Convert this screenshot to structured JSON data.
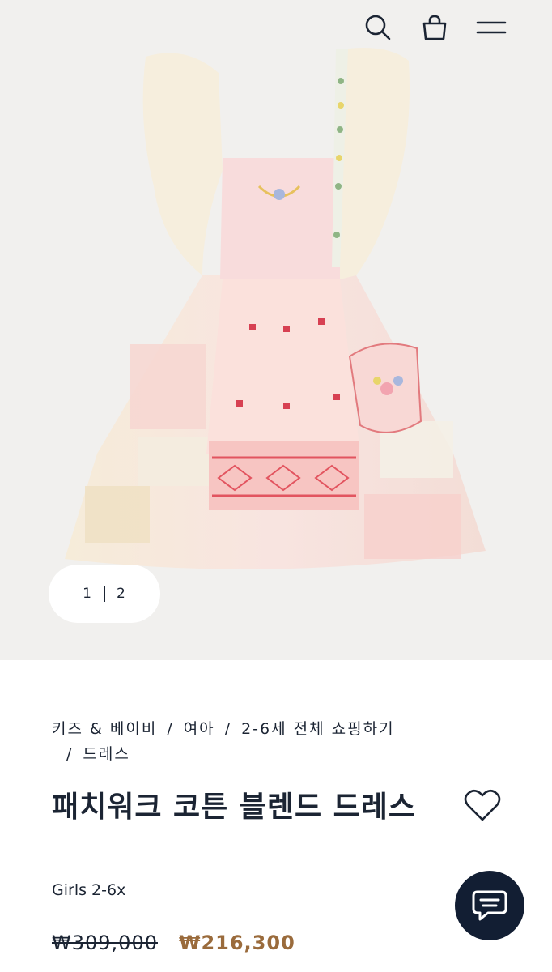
{
  "header": {
    "icons": [
      "search-icon",
      "shopping-bag-icon",
      "menu-icon"
    ]
  },
  "gallery": {
    "current": "1",
    "total": "2"
  },
  "breadcrumb": {
    "items": [
      "키즈 & 베이비",
      "여아",
      "2-6세 전체 쇼핑하기",
      "드레스"
    ]
  },
  "product": {
    "title": "패치워크 코튼 블렌드 드레스",
    "size_range": "Girls 2-6x",
    "original_price": "₩309,000",
    "sale_price": "₩216,300"
  },
  "colors": {
    "hero_bg": "#f1f0ee",
    "navy": "#121e33",
    "sale": "#9a6b3c"
  }
}
